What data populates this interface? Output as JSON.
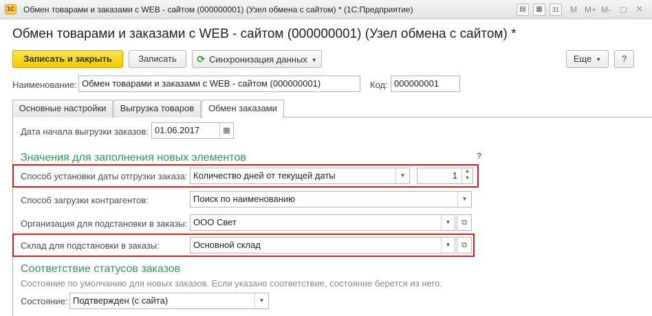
{
  "window": {
    "title": "Обмен товарами и заказами с WEB - сайтом (000000001) (Узел обмена с сайтом) * (1С:Предприятие)",
    "logo_text": "1С",
    "calendar_day": "31",
    "controls": {
      "m": "M",
      "mplus": "M+",
      "mminus": "M-",
      "restore": "□",
      "close": "×"
    }
  },
  "form": {
    "title": "Обмен товарами и заказами с WEB - сайтом (000000001) (Узел обмена с сайтом) *"
  },
  "toolbar": {
    "save_close": "Записать и закрыть",
    "save": "Записать",
    "sync": "Синхронизация данных",
    "more": "Еще",
    "help": "?"
  },
  "header_fields": {
    "name_label": "Наименование:",
    "name_value": "Обмен товарами и заказами с WEB - сайтом (000000001)",
    "code_label": "Код:",
    "code_value": "000000001"
  },
  "tabs": [
    {
      "label": "Основные настройки",
      "active": false
    },
    {
      "label": "Выгрузка товаров",
      "active": false
    },
    {
      "label": "Обмен заказами",
      "active": true
    }
  ],
  "orders": {
    "start_date_label": "Дата начала выгрузки заказов:",
    "start_date_value": "01.06.2017",
    "new_elements_title": "Значения для заполнения новых элементов",
    "help_mark": "?",
    "ship_date_label": "Способ установки даты отгрузки заказа:",
    "ship_date_value": "Количество дней от текущей даты",
    "ship_days_value": "1",
    "contractors_label": "Способ загрузки контрагентов:",
    "contractors_value": "Поиск по наименованию",
    "org_label": "Организация для подстановки в заказы:",
    "org_value": "ООО Свет",
    "warehouse_label": "Склад для подстановки в заказы:",
    "warehouse_value": "Основной склад",
    "statuses_title": "Соответствие статусов заказов",
    "statuses_note": "Состояние по умолчанию для новых заказов. Если указано соответствие, состояние берется из него.",
    "state_label": "Состояние:",
    "state_value": "Подтвержден (с сайта)"
  },
  "colors": {
    "accent_yellow": "#f3c900",
    "section_green": "#2b9a5a",
    "highlight_red": "#e0191f"
  }
}
